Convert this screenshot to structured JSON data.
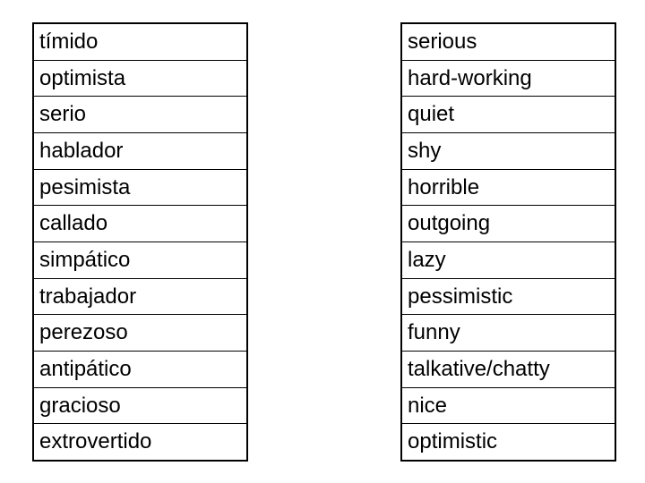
{
  "spanish_words": [
    "tímido",
    "optimista",
    "serio",
    "hablador",
    "pesimista",
    "callado",
    "simpático",
    "trabajador",
    "perezoso",
    "antipático",
    "gracioso",
    "extrovertido"
  ],
  "english_words": [
    "serious",
    "hard-working",
    "quiet",
    "shy",
    "horrible",
    "outgoing",
    "lazy",
    "pessimistic",
    "funny",
    "talkative/chatty",
    "nice",
    "optimistic"
  ]
}
